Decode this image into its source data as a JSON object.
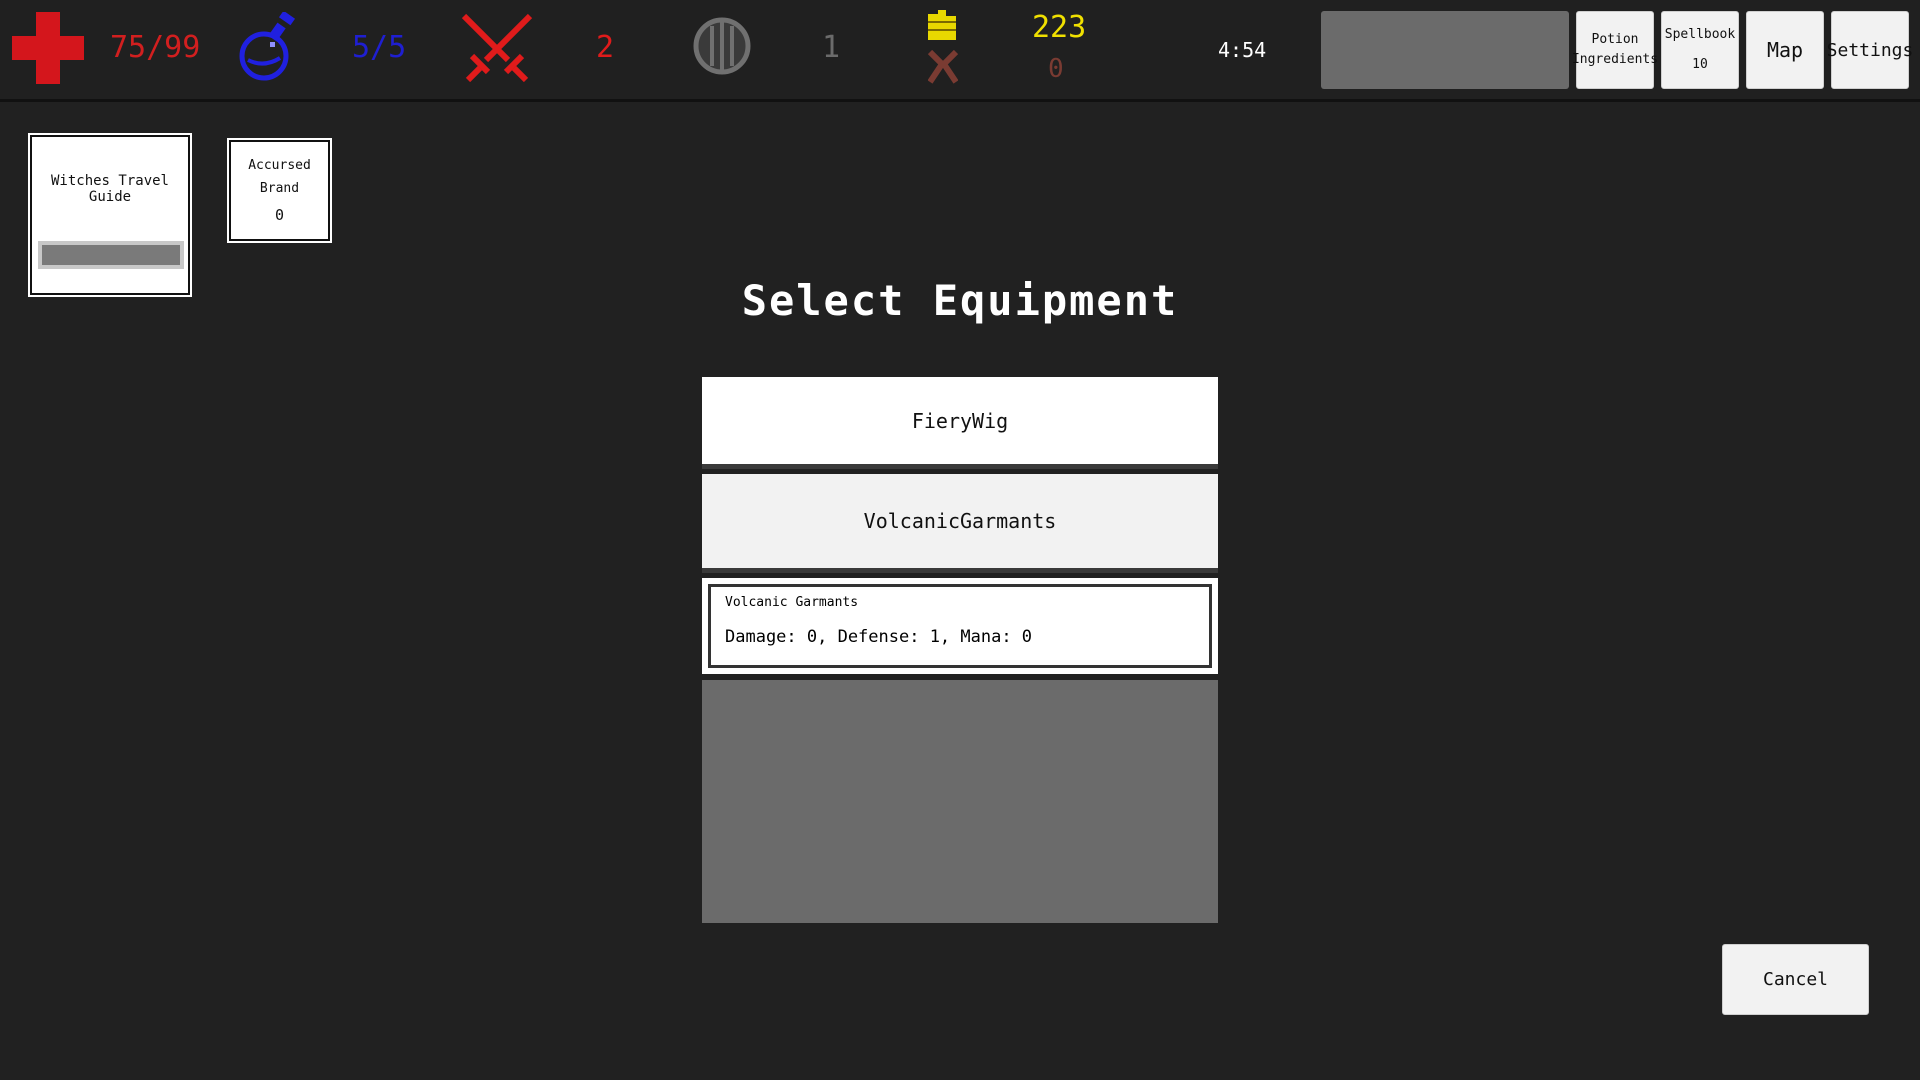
{
  "hud": {
    "health": "75/99",
    "mana": "5/5",
    "attack": "2",
    "defense": "1",
    "gold": "223",
    "gold_other": "0",
    "timer": "4:54",
    "colors": {
      "health": "#d21f1f",
      "mana": "#1f1fd2",
      "attack": "#e01b1b",
      "defense": "#6b6b6b",
      "gold": "#f0e000",
      "gold_other": "#7a3b32"
    },
    "icons": [
      "health-cross-icon",
      "mana-potion-icon",
      "crossed-swords-icon",
      "shield-icon",
      "gold-coins-icon",
      "gold-other-icon"
    ]
  },
  "menu": {
    "potion_line1": "Potion",
    "potion_line2": "Ingredients",
    "spellbook_label": "Spellbook",
    "spellbook_count": "10",
    "map_label": "Map",
    "settings_label": "Settings"
  },
  "relics": [
    {
      "name": "Witches Travel Guide",
      "progress": 1.0
    },
    {
      "name_line1": "Accursed",
      "name_line2": "Brand",
      "count": "0"
    }
  ],
  "dialog": {
    "title": "Select Equipment",
    "items": [
      "FieryWig",
      "VolcanicGarmants"
    ],
    "tooltip": {
      "name": "Volcanic Garmants",
      "stats": "Damage: 0, Defense: 1, Mana: 0"
    }
  },
  "cancel_label": "Cancel"
}
